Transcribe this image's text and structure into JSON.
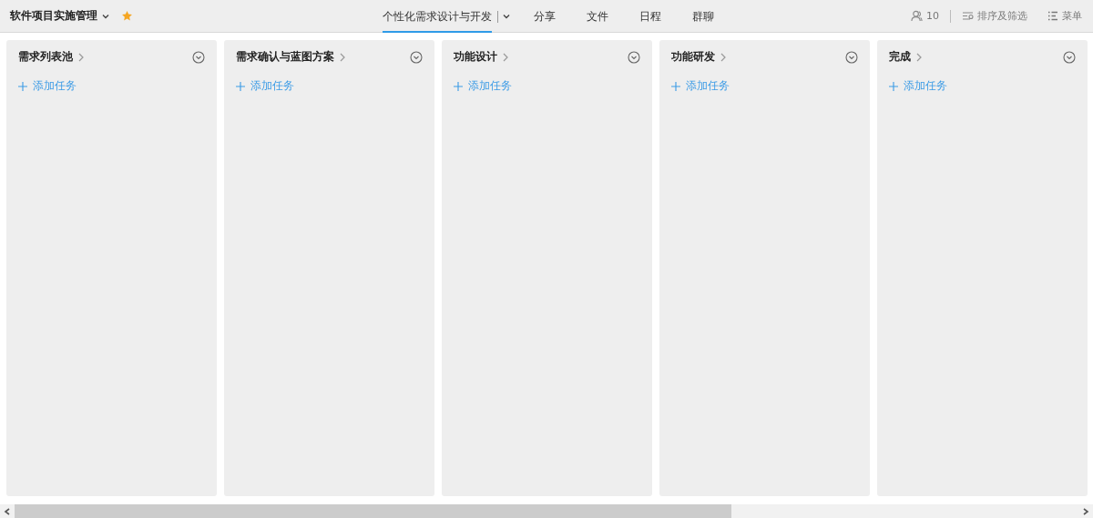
{
  "project": {
    "title": "软件项目实施管理",
    "starred": true
  },
  "tabs": [
    {
      "label": "个性化需求设计与开发",
      "selected": true,
      "has_menu": true
    },
    {
      "label": "分享",
      "selected": false,
      "has_menu": false
    },
    {
      "label": "文件",
      "selected": false,
      "has_menu": false
    },
    {
      "label": "日程",
      "selected": false,
      "has_menu": false
    },
    {
      "label": "群聊",
      "selected": false,
      "has_menu": false
    }
  ],
  "toolbar": {
    "members": "10",
    "sort_filter": "排序及筛选",
    "menu": "菜单"
  },
  "columns": [
    {
      "title": "需求列表池",
      "add_task": "添加任务"
    },
    {
      "title": "需求确认与蓝图方案",
      "add_task": "添加任务"
    },
    {
      "title": "功能设计",
      "add_task": "添加任务"
    },
    {
      "title": "功能研发",
      "add_task": "添加任务"
    },
    {
      "title": "完成",
      "add_task": "添加任务"
    }
  ]
}
